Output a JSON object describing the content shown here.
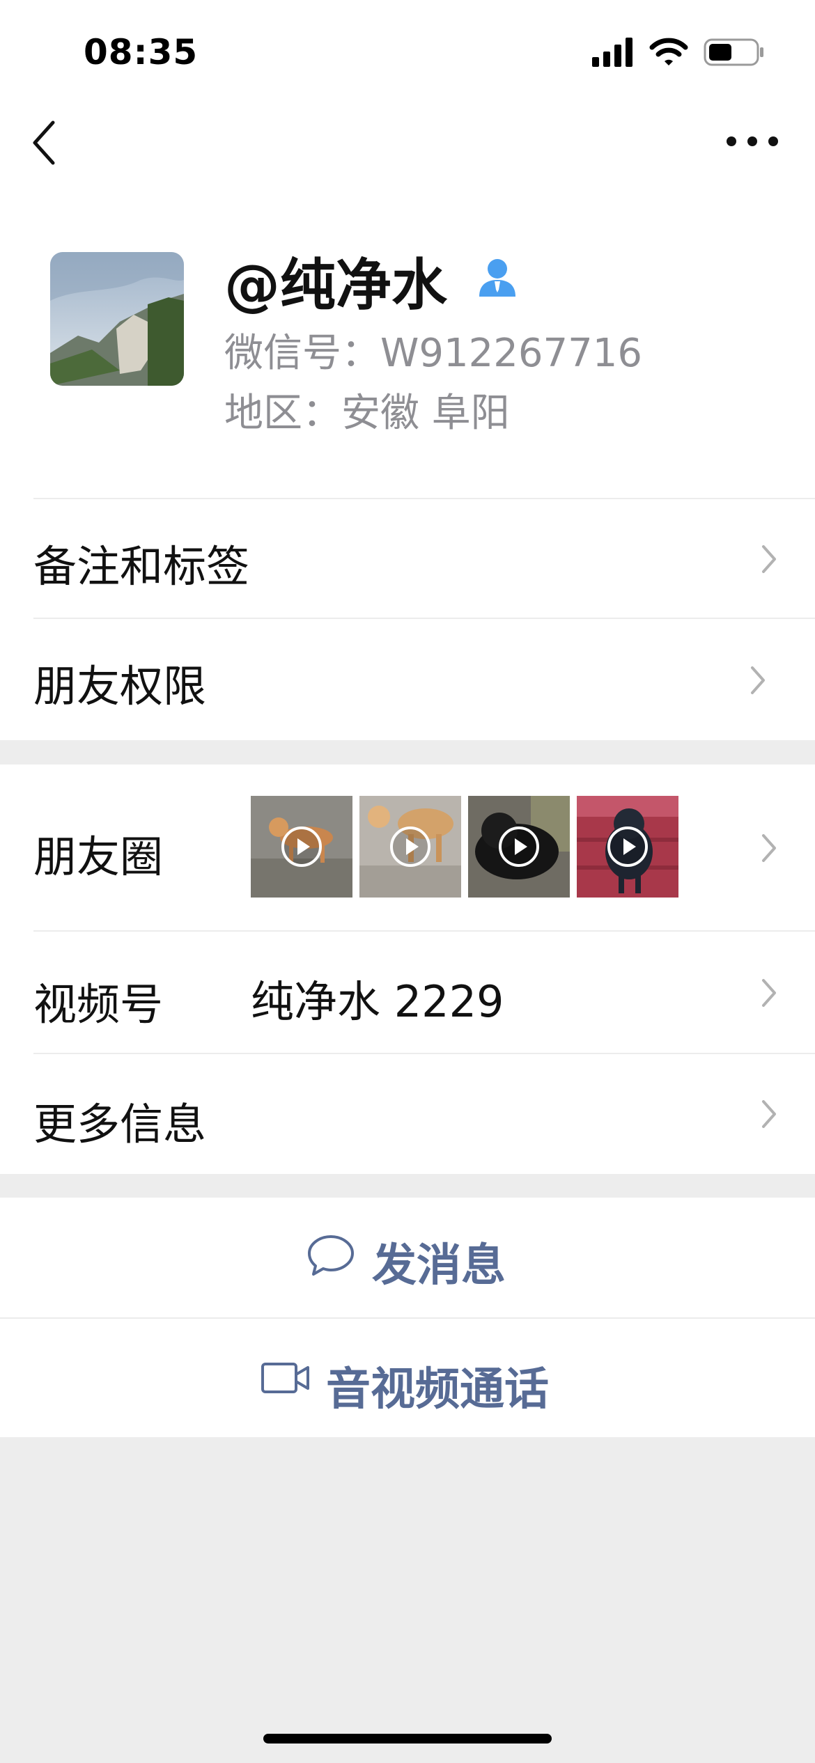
{
  "status_bar": {
    "time": "08:35",
    "icons": [
      "signal-icon",
      "wifi-icon",
      "battery-icon"
    ]
  },
  "nav": {
    "back_icon": "chevron-left-icon",
    "more_icon": "more-dots-icon"
  },
  "profile": {
    "name": "@纯净水",
    "wechat_id_label": "微信号：",
    "wechat_id": "W912267716",
    "region_label": "地区：",
    "region": "安徽 阜阳",
    "verify_icon": "person-badge-icon"
  },
  "rows": {
    "remark_tags": "备注和标签",
    "friend_permission": "朋友权限",
    "moments": "朋友圈",
    "channels_label": "视频号",
    "channels_value": "纯净水 2229",
    "more_info": "更多信息"
  },
  "moments_thumbs": [
    {
      "name": "video-thumb-1",
      "icon": "play-icon"
    },
    {
      "name": "video-thumb-2",
      "icon": "play-icon"
    },
    {
      "name": "video-thumb-3",
      "icon": "play-icon"
    },
    {
      "name": "video-thumb-4",
      "icon": "play-icon"
    }
  ],
  "actions": {
    "send_message": "发消息",
    "send_message_icon": "chat-bubble-icon",
    "av_call": "音视频通话",
    "av_call_icon": "video-camera-icon"
  },
  "colors": {
    "link_blue": "#576b95",
    "background": "#ededed",
    "secondary_text": "#8e8e93",
    "verify_blue": "#4a9ff0"
  }
}
